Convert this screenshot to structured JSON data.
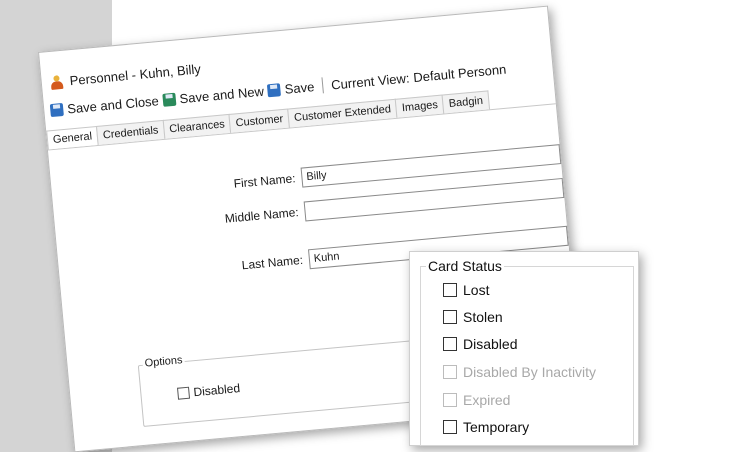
{
  "window": {
    "title": "Personnel  -  Kuhn, Billy"
  },
  "toolbar": {
    "save_close": "Save and Close",
    "save_new": "Save and New",
    "save": "Save",
    "current_view_label": "Current View:",
    "current_view_value": "Default Personn"
  },
  "tabs": [
    "General",
    "Credentials",
    "Clearances",
    "Customer",
    "Customer Extended",
    "Images",
    "Badgin"
  ],
  "fields": {
    "first_name_label": "First Name:",
    "first_name_value": "Billy",
    "middle_name_label": "Middle Name:",
    "middle_name_value": "",
    "last_name_label": "Last Name:",
    "last_name_value": "Kuhn"
  },
  "options": {
    "legend": "Options",
    "disabled_label": "Disabled"
  },
  "card_status": {
    "legend": "Card Status",
    "items": [
      {
        "label": "Lost",
        "enabled": true
      },
      {
        "label": "Stolen",
        "enabled": true
      },
      {
        "label": "Disabled",
        "enabled": true
      },
      {
        "label": "Disabled By Inactivity",
        "enabled": false
      },
      {
        "label": "Expired",
        "enabled": false
      },
      {
        "label": "Temporary",
        "enabled": true
      }
    ]
  }
}
